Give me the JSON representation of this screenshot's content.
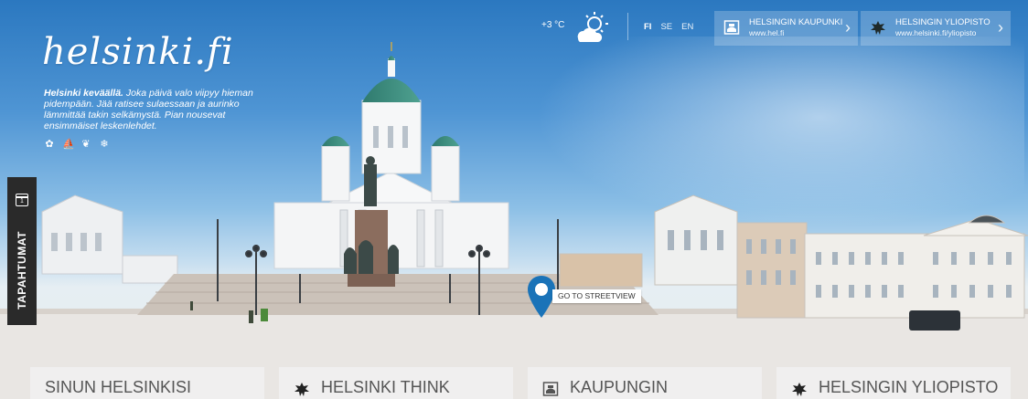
{
  "brand": {
    "logo": "helsinki.fi",
    "intro_bold": "Helsinki keväällä.",
    "intro_text": "Joka päivä valo viipyy hieman pidempään. Jää ratisee sulaessaan ja aurinko lämmittää takin selkämystä. Pian nousevat ensimmäiset leskenlehdet.",
    "season_icons": [
      "flower-icon",
      "boat-icon",
      "leaf-icon",
      "snowflake-icon"
    ]
  },
  "weather": {
    "temperature": "+3 °C",
    "icon": "sun-cloud-icon"
  },
  "languages": [
    {
      "code": "FI",
      "active": true
    },
    {
      "code": "SE",
      "active": false
    },
    {
      "code": "EN",
      "active": false
    }
  ],
  "partners": [
    {
      "name": "HELSINGIN KAUPUNKI",
      "url": "www.hel.fi",
      "icon": "city-crest-icon"
    },
    {
      "name": "HELSINGIN YLIOPISTO",
      "url": "www.helsinki.fi/yliopisto",
      "icon": "university-bird-icon"
    }
  ],
  "events_tab": {
    "label": "TAPAHTUMAT",
    "calendar_day": "1"
  },
  "streetview": {
    "label": "GO TO STREETVIEW",
    "pin_color": "#1a73b8"
  },
  "cards": [
    {
      "label": "SINUN HELSINKISI",
      "icon": ""
    },
    {
      "label": "HELSINKI THINK",
      "icon": "university-bird-icon"
    },
    {
      "label": "KAUPUNGIN",
      "icon": "city-crest-icon"
    },
    {
      "label": "HELSINGIN YLIOPISTO",
      "icon": "university-bird-icon"
    }
  ]
}
